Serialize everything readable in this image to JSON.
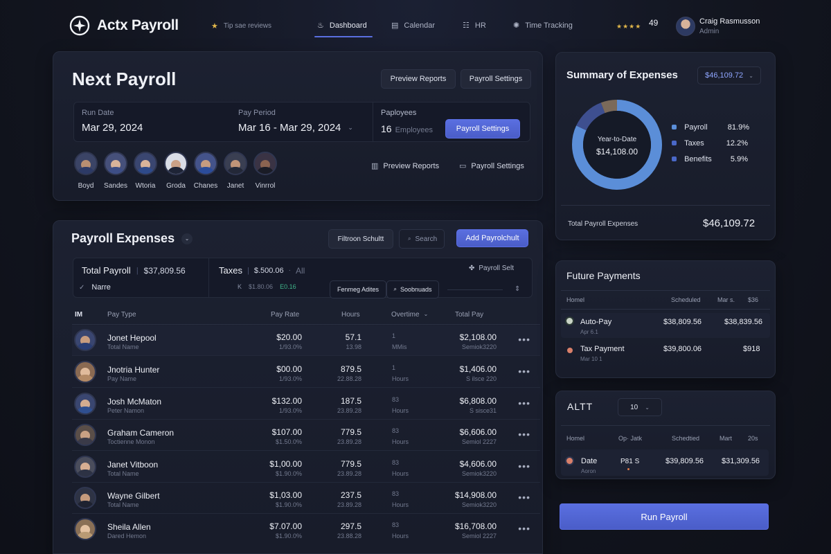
{
  "app": {
    "logo_text": "Actx Payroll",
    "reviews_text": "Tip sae reviews"
  },
  "nav": {
    "items": [
      {
        "label": "Dashboard",
        "icon": "flame-icon",
        "active": true
      },
      {
        "label": "Calendar",
        "icon": "calendar-icon",
        "active": false
      },
      {
        "label": "HR",
        "icon": "grid-icon",
        "active": false
      },
      {
        "label": "Time Tracking",
        "icon": "clock-icon",
        "active": false
      }
    ],
    "rating_badge": "49",
    "user": {
      "name": "Craig Rasmusson",
      "role": "Admin"
    }
  },
  "next_payroll": {
    "title": "Next Payroll",
    "preview_reports_label": "Preview Reports",
    "payroll_settings_label": "Payroll Settings",
    "run_date_label": "Run Date",
    "run_date_value": "Mar 29, 2024",
    "pay_period_label": "Pay Period",
    "pay_period_value": "Mar 16 - Mar 29, 2024",
    "employees_label": "Paployees",
    "employees_count": "16",
    "employees_unit": "Employees",
    "inline_settings_label": "Payroll Settings",
    "members": [
      "Boyd",
      "Sandes",
      "Wtoria",
      "Groda",
      "Chanes",
      "Janet",
      "Vinrrol"
    ],
    "link_preview_reports": "Preview Reports",
    "link_payroll_settings": "Payroll Settings"
  },
  "payroll_expenses": {
    "title": "Payroll Expenses",
    "filter_label": "Filtroon Schultt",
    "search_placeholder": "Search",
    "add_label": "Add Payrolchult",
    "total_payroll_label": "Total Payroll",
    "total_payroll_value": "$37,809.56",
    "taxes_label": "Taxes",
    "taxes_value": "$.500.06",
    "taxes_all": "All",
    "payroll_selt": "Payroll Selt",
    "name_label": "Narre",
    "filter_k_val": "$1.80.06",
    "filter_k_green": "E0.16",
    "chip_pay": "Fenmeg Adites",
    "chip_sort": "Soobnuads",
    "columns": {
      "id": "ІМ",
      "pay_type": "Pay Type",
      "pay_rate": "Pay Rate",
      "hours": "Hours",
      "overtime": "Overtime",
      "total_pay": "Total Pay"
    },
    "rows": [
      {
        "name": "Jonet Hepool",
        "sub": "Total Name",
        "rate": "$20.00",
        "rate_sub": "1/93.0%",
        "hours": "57.1",
        "hours_sub": "13.98",
        "ot": "1",
        "ot_sub": "MMis",
        "total": "$2,108.00",
        "total_sub": "Semiok3220"
      },
      {
        "name": "Jnotria Hunter",
        "sub": "Pay Name",
        "rate": "$00.00",
        "rate_sub": "1/93.0%",
        "hours": "879.5",
        "hours_sub": "22.88.28",
        "ot": "1",
        "ot_sub": "Hours",
        "total": "$1,406.00",
        "total_sub": "S ilsce 220"
      },
      {
        "name": "Josh McMaton",
        "sub": "Peter Namon",
        "rate": "$132.00",
        "rate_sub": "1/93.0%",
        "hours": "187.5",
        "hours_sub": "23.89.28",
        "ot": "83",
        "ot_sub": "Hours",
        "total": "$6,808.00",
        "total_sub": "S sisce31"
      },
      {
        "name": "Graham Cameron",
        "sub": "Toctienne Monon",
        "rate": "$107.00",
        "rate_sub": "$1.50.0%",
        "hours": "779.5",
        "hours_sub": "23.89.28",
        "ot": "83",
        "ot_sub": "Hours",
        "total": "$6,606.00",
        "total_sub": "Semiol 2227"
      },
      {
        "name": "Janet Vitboon",
        "sub": "Total Name",
        "rate": "$1,00.00",
        "rate_sub": "$1.90.0%",
        "hours": "779.5",
        "hours_sub": "23.89.28",
        "ot": "83",
        "ot_sub": "Hours",
        "total": "$4,606.00",
        "total_sub": "Semiok3220"
      },
      {
        "name": "Wayne Gilbert",
        "sub": "Total Name",
        "rate": "$1,03.00",
        "rate_sub": "$1.90.0%",
        "hours": "237.5",
        "hours_sub": "23.89.28",
        "ot": "83",
        "ot_sub": "Hours",
        "total": "$14,908.00",
        "total_sub": "Semiok3220"
      },
      {
        "name": "Sheila Allen",
        "sub": "Dared Hemon",
        "rate": "$7.07.00",
        "rate_sub": "$1.90.0%",
        "hours": "297.5",
        "hours_sub": "23.88.28",
        "ot": "83",
        "ot_sub": "Hours",
        "total": "$16,708.00",
        "total_sub": "Semiol 2227"
      }
    ]
  },
  "summary": {
    "title": "Summary of Expenses",
    "total_select": "$46,109.72",
    "donut_label": "Year-to-Date",
    "donut_value": "$14,108.00",
    "legend": [
      {
        "label": "Payroll",
        "value": "81.9%"
      },
      {
        "label": "Taxes",
        "value": "12.2%"
      },
      {
        "label": "Benefits",
        "value": "5.9%"
      }
    ],
    "total_label": "Total Payroll Expenses",
    "total_value": "$46,109.72",
    "colors": {
      "payroll": "#5b8ed8",
      "taxes": "#3e4f8f",
      "benefits": "#7b6a5a"
    }
  },
  "future_payments": {
    "title": "Future Payments",
    "columns": {
      "name": "Homel",
      "scheduled": "Scheduled",
      "mar": "Mar s.",
      "amount": "$36"
    },
    "rows": [
      {
        "name": "Auto-Pay",
        "sub": "Apr 6.1",
        "scheduled": "$38,809.56",
        "amount": "$38,839.56"
      },
      {
        "name": "Tax Payment",
        "sub": "Mar 10 1",
        "scheduled": "$39,800.06",
        "amount": "$918"
      }
    ]
  },
  "alt_panel": {
    "title": "ALTT",
    "select_value": "10",
    "columns": {
      "name": "Homel",
      "opt": "Op· Jatk",
      "scheduled": "Schedtied",
      "mart": "Mart",
      "twenty": "20s"
    },
    "row": {
      "name": "Date",
      "sub": "Aoron",
      "code": "P81 S",
      "scheduled": "$39,809.56",
      "amount": "$31,309.56"
    }
  },
  "run_payroll_label": "Run Payroll"
}
